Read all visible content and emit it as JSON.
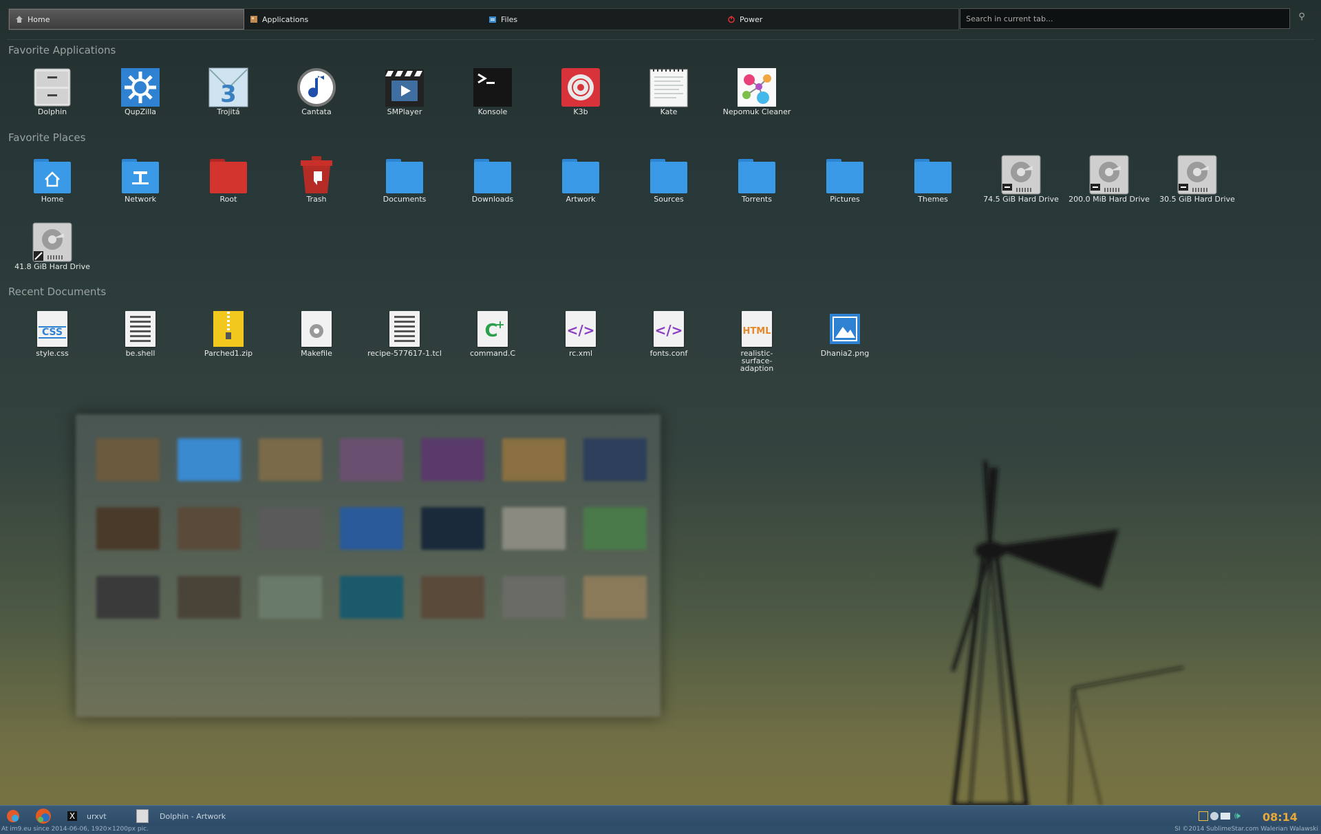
{
  "topbar": {
    "tabs": [
      {
        "label": "Home",
        "icon": "home-icon"
      },
      {
        "label": "Applications",
        "icon": "applications-icon"
      },
      {
        "label": "Files",
        "icon": "files-icon"
      },
      {
        "label": "Power",
        "icon": "power-icon"
      }
    ],
    "search_placeholder": "Search in current tab..."
  },
  "favorite_applications": {
    "title": "Favorite Applications",
    "items": [
      {
        "label": "Dolphin",
        "icon": "dolphin-icon"
      },
      {
        "label": "QupZilla",
        "icon": "qupzilla-icon"
      },
      {
        "label": "Trojitá",
        "icon": "trojita-icon"
      },
      {
        "label": "Cantata",
        "icon": "cantata-icon"
      },
      {
        "label": "SMPlayer",
        "icon": "smplayer-icon"
      },
      {
        "label": "Konsole",
        "icon": "konsole-icon"
      },
      {
        "label": "K3b",
        "icon": "k3b-icon"
      },
      {
        "label": "Kate",
        "icon": "kate-icon"
      },
      {
        "label": "Nepomuk Cleaner",
        "icon": "nepomuk-icon"
      }
    ]
  },
  "favorite_places": {
    "title": "Favorite Places",
    "items": [
      {
        "label": "Home",
        "icon": "home-folder-icon"
      },
      {
        "label": "Network",
        "icon": "network-folder-icon"
      },
      {
        "label": "Root",
        "icon": "root-folder-icon"
      },
      {
        "label": "Trash",
        "icon": "trash-icon"
      },
      {
        "label": "Documents",
        "icon": "folder-icon"
      },
      {
        "label": "Downloads",
        "icon": "folder-icon"
      },
      {
        "label": "Artwork",
        "icon": "folder-icon"
      },
      {
        "label": "Sources",
        "icon": "folder-icon"
      },
      {
        "label": "Torrents",
        "icon": "folder-icon"
      },
      {
        "label": "Pictures",
        "icon": "folder-icon"
      },
      {
        "label": "Themes",
        "icon": "folder-icon"
      },
      {
        "label": "74.5 GiB Hard Drive",
        "icon": "hard-drive-icon"
      },
      {
        "label": "200.0 MiB Hard Drive",
        "icon": "hard-drive-icon"
      },
      {
        "label": "30.5 GiB Hard Drive",
        "icon": "hard-drive-icon"
      },
      {
        "label": "41.8 GiB Hard Drive",
        "icon": "hard-drive-icon"
      }
    ]
  },
  "recent_documents": {
    "title": "Recent Documents",
    "items": [
      {
        "label": "style.css",
        "icon": "css-file-icon"
      },
      {
        "label": "be.shell",
        "icon": "text-file-icon"
      },
      {
        "label": "Parched1.zip",
        "icon": "zip-file-icon"
      },
      {
        "label": "Makefile",
        "icon": "makefile-icon"
      },
      {
        "label": "recipe-577617-1.tcl",
        "icon": "text-file-icon"
      },
      {
        "label": "command.C",
        "icon": "cpp-file-icon"
      },
      {
        "label": "rc.xml",
        "icon": "xml-file-icon"
      },
      {
        "label": "fonts.conf",
        "icon": "xml-file-icon"
      },
      {
        "label": "realistic-surface-adaption",
        "icon": "html-file-icon"
      },
      {
        "label": "Dhania2.png",
        "icon": "image-file-icon"
      }
    ]
  },
  "taskbar": {
    "tasks": [
      {
        "label": "urxvt",
        "icon": "x-icon"
      },
      {
        "label": "Dolphin - Artwork",
        "icon": "dolphin-icon"
      }
    ],
    "clock": "08:14",
    "status_left": "At im9.eu since 2014-06-06, 1920×1200px pic.",
    "status_right": "SI ©2014 SublimeStar.com Walerian Walawski"
  }
}
